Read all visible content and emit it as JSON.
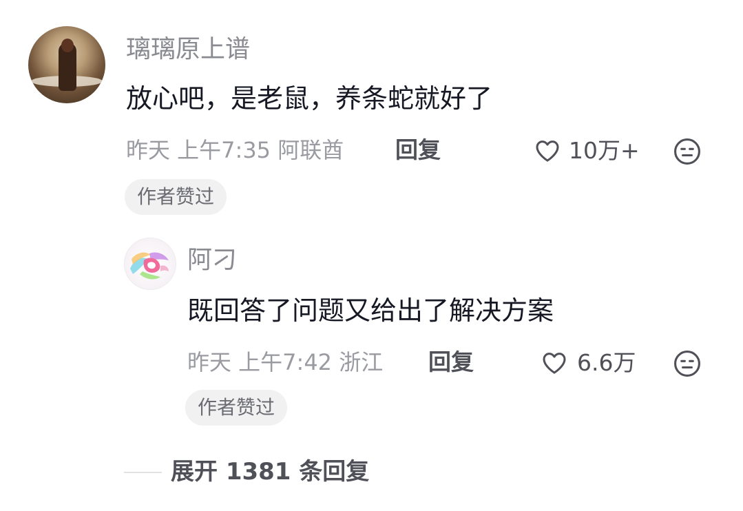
{
  "comments": [
    {
      "username": "璃璃原上谱",
      "avatar_icon": "user-photo-avatar",
      "content": "放心吧，是老鼠，养条蛇就好了",
      "meta": "昨天 上午7:35 阿联酋",
      "reply_label": "回复",
      "like_count": "10万+",
      "badge": "作者赞过"
    },
    {
      "username": "阿刁",
      "avatar_icon": "colorful-abstract-avatar",
      "content": "既回答了问题又给出了解决方案",
      "meta": "昨天 上午7:42 浙江",
      "reply_label": "回复",
      "like_count": "6.6万",
      "badge": "作者赞过"
    }
  ],
  "expand": {
    "label": "展开 1381 条回复"
  },
  "icons": {
    "like": "heart-outline-icon",
    "dislike": "sad-face-icon"
  },
  "colors": {
    "text_primary": "#161823",
    "text_secondary": "#9a9ba1",
    "badge_bg": "#f1f1f2"
  }
}
